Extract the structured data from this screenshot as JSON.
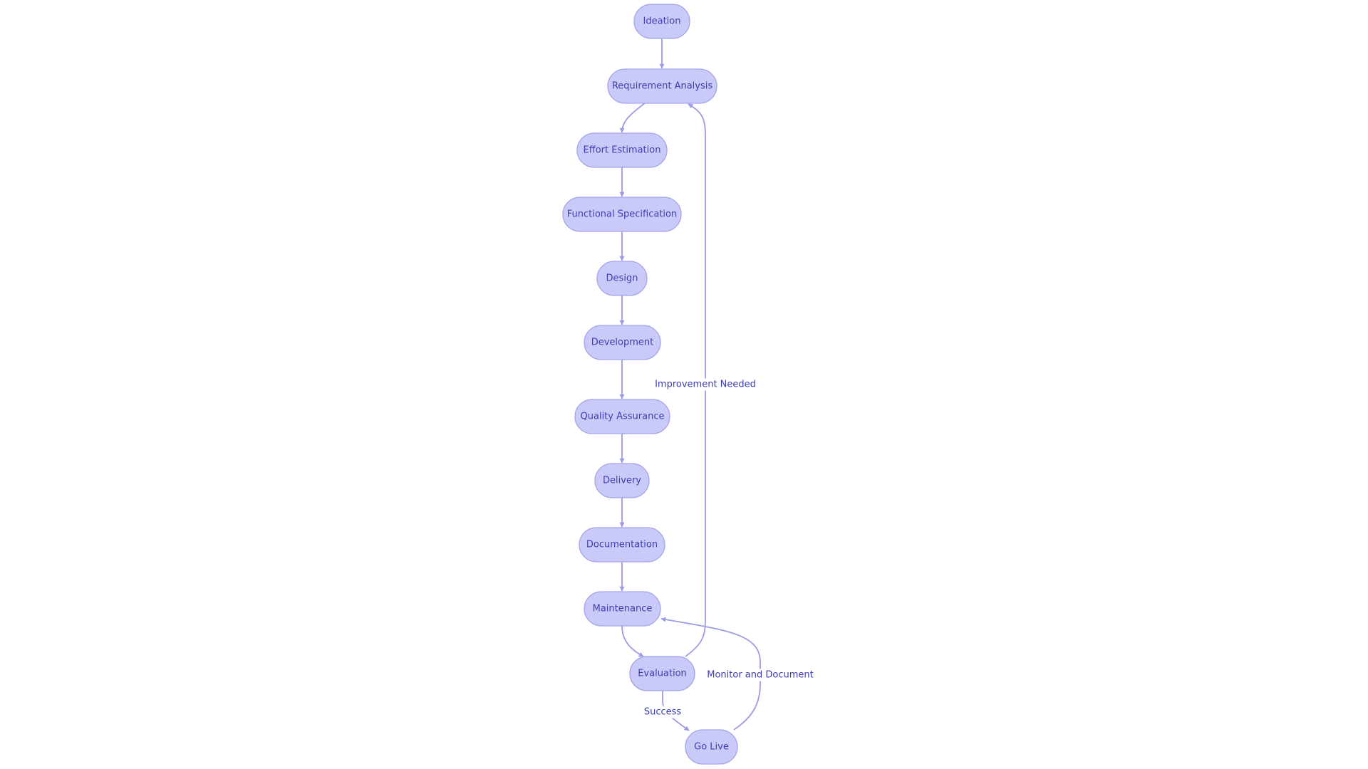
{
  "diagram": {
    "type": "flowchart",
    "direction": "top-down",
    "colors": {
      "node_fill": "#cacaf8",
      "node_stroke": "#a3a3ea",
      "text": "#3d3db3",
      "edge": "#9b9be6"
    },
    "nodes": [
      {
        "id": "ideation",
        "label": "Ideation"
      },
      {
        "id": "requirement_analysis",
        "label": "Requirement Analysis"
      },
      {
        "id": "effort_estimation",
        "label": "Effort Estimation"
      },
      {
        "id": "functional_specification",
        "label": "Functional Specification"
      },
      {
        "id": "design",
        "label": "Design"
      },
      {
        "id": "development",
        "label": "Development"
      },
      {
        "id": "quality_assurance",
        "label": "Quality Assurance"
      },
      {
        "id": "delivery",
        "label": "Delivery"
      },
      {
        "id": "documentation",
        "label": "Documentation"
      },
      {
        "id": "maintenance",
        "label": "Maintenance"
      },
      {
        "id": "evaluation",
        "label": "Evaluation"
      },
      {
        "id": "go_live",
        "label": "Go Live"
      }
    ],
    "edges": [
      {
        "from": "ideation",
        "to": "requirement_analysis",
        "label": ""
      },
      {
        "from": "requirement_analysis",
        "to": "effort_estimation",
        "label": ""
      },
      {
        "from": "effort_estimation",
        "to": "functional_specification",
        "label": ""
      },
      {
        "from": "functional_specification",
        "to": "design",
        "label": ""
      },
      {
        "from": "design",
        "to": "development",
        "label": ""
      },
      {
        "from": "development",
        "to": "quality_assurance",
        "label": ""
      },
      {
        "from": "quality_assurance",
        "to": "delivery",
        "label": ""
      },
      {
        "from": "delivery",
        "to": "documentation",
        "label": ""
      },
      {
        "from": "documentation",
        "to": "maintenance",
        "label": ""
      },
      {
        "from": "maintenance",
        "to": "evaluation",
        "label": ""
      },
      {
        "from": "evaluation",
        "to": "requirement_analysis",
        "label": "Improvement Needed"
      },
      {
        "from": "evaluation",
        "to": "go_live",
        "label": "Success"
      },
      {
        "from": "go_live",
        "to": "maintenance",
        "label": "Monitor and Document"
      }
    ]
  }
}
